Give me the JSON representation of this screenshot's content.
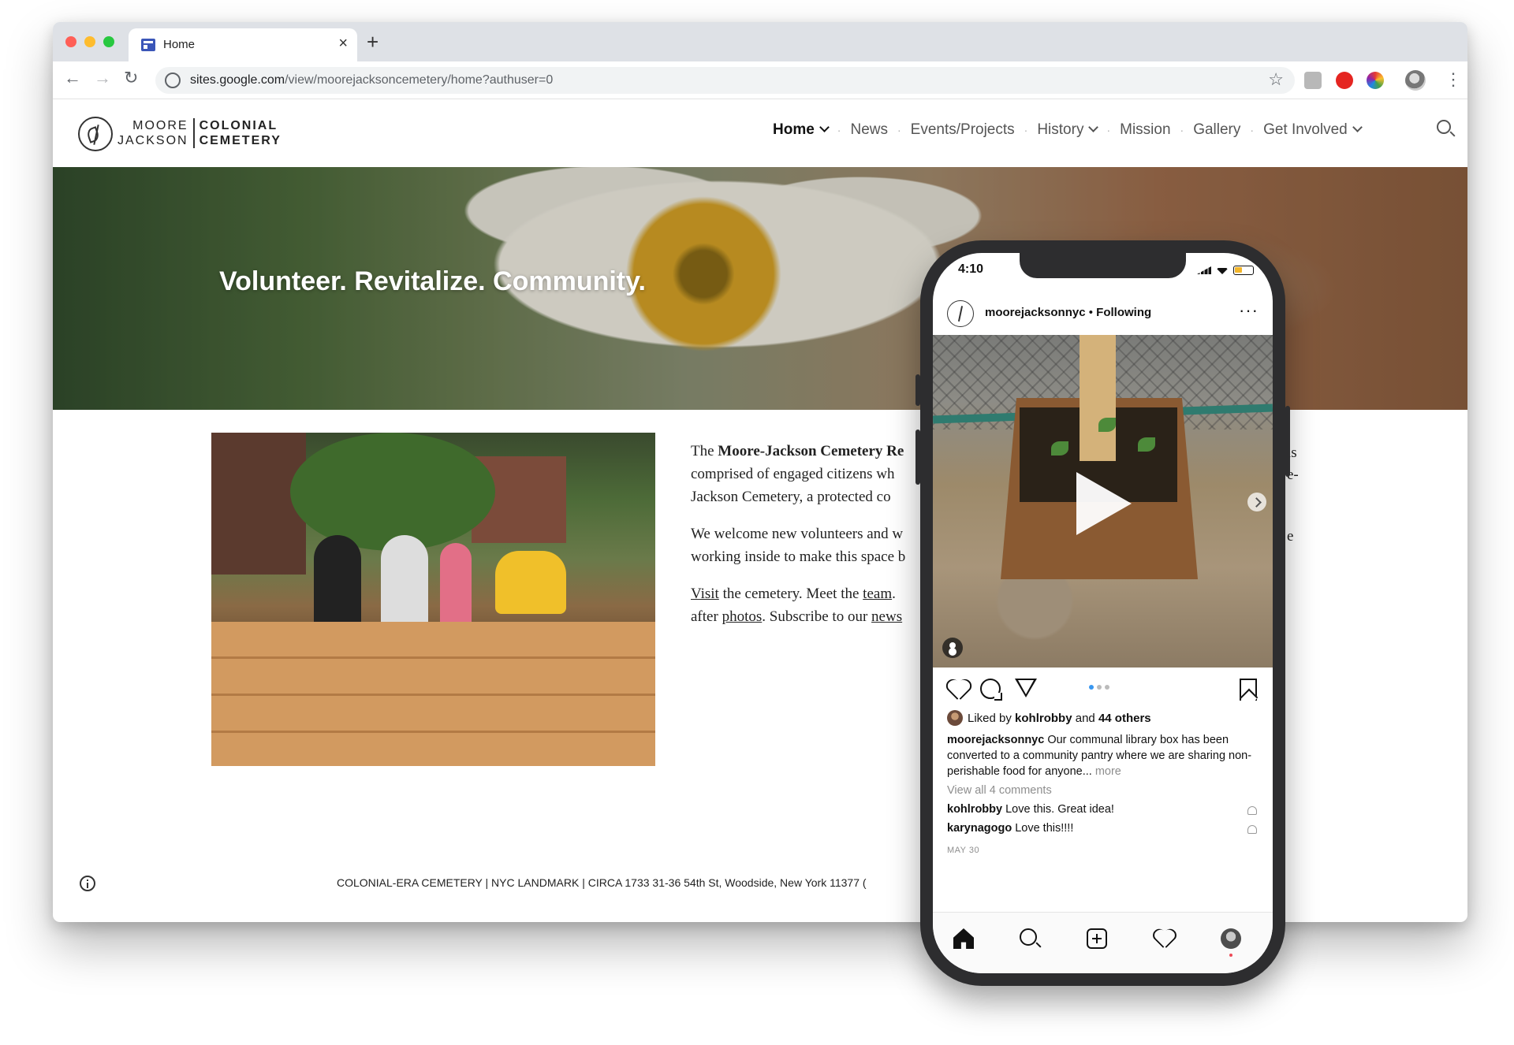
{
  "browser": {
    "tab_title": "Home",
    "close_glyph": "×",
    "new_tab_glyph": "+",
    "url_domain": "sites.google.com",
    "url_path": "/view/moorejacksoncemetery/home?authuser=0",
    "back_glyph": "←",
    "forward_glyph": "→",
    "reload_glyph": "↻",
    "star_glyph": "☆",
    "menu_glyph": "⋮"
  },
  "site": {
    "logo": {
      "left_line1": "MOORE",
      "left_line2": "JACKSON",
      "right_line1": "COLONIAL",
      "right_line2": "CEMETERY"
    },
    "nav": {
      "sep": "·",
      "items": [
        {
          "label": "Home"
        },
        {
          "label": "News"
        },
        {
          "label": "Events/Projects"
        },
        {
          "label": "History"
        },
        {
          "label": "Mission"
        },
        {
          "label": "Gallery"
        },
        {
          "label": "Get Involved"
        }
      ]
    },
    "hero_title": "Volunteer. Revitalize. Community.",
    "body": {
      "p1_a": "The ",
      "p1_b": "Moore-Jackson Cemetery Re",
      "p1_line2": "comprised of engaged citizens wh",
      "p1_line3": "Jackson Cemetery, a protected co",
      "p2_line1": "We welcome new volunteers and w",
      "p2_line2": "working inside to make this space b",
      "p3_a": "Visit",
      "p3_b": " the cemetery. Meet the ",
      "p3_c": "team",
      "p3_d": ".",
      "p3_line2a": "after ",
      "p3_line2b": "photos",
      "p3_line2c": ". Subscribe to our ",
      "p3_line2d": "news",
      "right_frag1": "is",
      "right_frag2": "e-",
      "right_frag3": "e"
    },
    "footer": {
      "text": "COLONIAL-ERA CEMETERY  |  NYC LANDMARK  |  CIRCA 1733       31-36 54th St, Woodside, New York 11377      ("
    }
  },
  "phone": {
    "time": "4:10",
    "ig": {
      "username": "moorejacksonnyc",
      "following": "Following",
      "more_glyph": "···",
      "likes_prefix": "Liked by ",
      "likes_user": "kohlrobby",
      "likes_mid": " and ",
      "likes_count": "44 others",
      "caption_user": "moorejacksonnyc",
      "caption_text": " Our communal library box has been converted to a community pantry where we are sharing non-perishable food for anyone...",
      "caption_more": " more",
      "view_all": "View all 4 comments",
      "comments": [
        {
          "user": "kohlrobby",
          "text": " Love this. Great idea!"
        },
        {
          "user": "karynagogo",
          "text": " Love this!!!!"
        }
      ],
      "date": "MAY 30"
    }
  }
}
